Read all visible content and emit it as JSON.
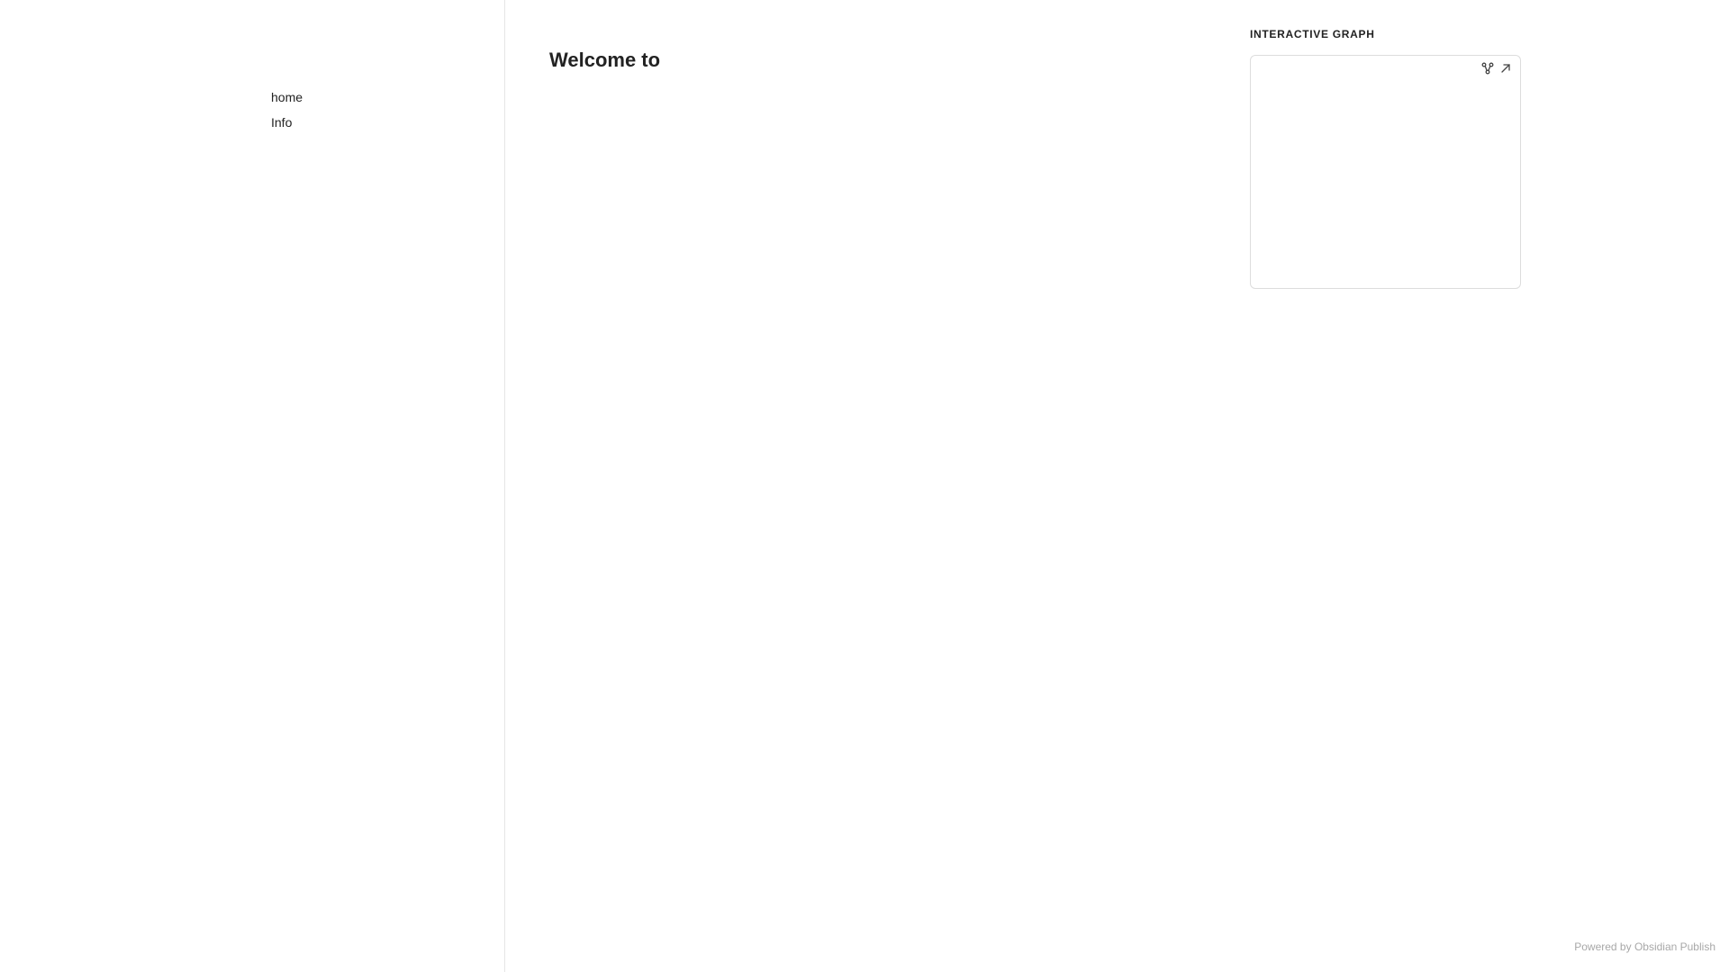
{
  "nav": {
    "items": [
      {
        "label": "home"
      },
      {
        "label": "Info"
      }
    ]
  },
  "main": {
    "title": "Welcome to"
  },
  "graph": {
    "heading": "INTERACTIVE GRAPH",
    "controls": [
      {
        "icon": "graph-nodes-icon"
      },
      {
        "icon": "arrow-up-right-icon"
      }
    ]
  },
  "footer": {
    "text": "Powered by Obsidian Publish"
  }
}
